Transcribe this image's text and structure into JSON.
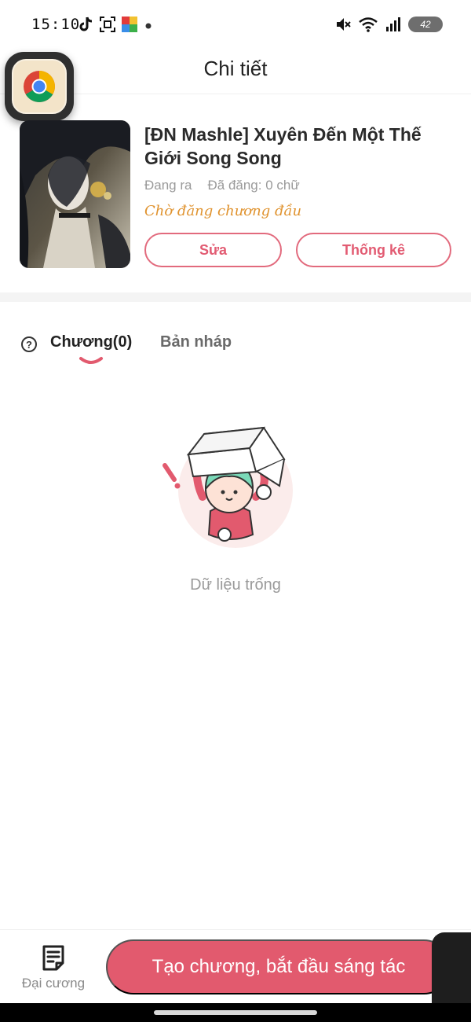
{
  "status_bar": {
    "time": "15:10",
    "left_icons": [
      "tiktok-icon",
      "scan-icon",
      "colorful-app-icon",
      "dot-icon"
    ],
    "right_icons": [
      "mute-icon",
      "wifi-icon",
      "signal-icon"
    ],
    "battery": "42"
  },
  "header": {
    "title": "Chi tiết"
  },
  "book": {
    "title": "[ĐN Mashle] Xuyên Đến Một Thế Giới Song Song",
    "status": "Đang ra",
    "word_count": "Đã đăng: 0 chữ",
    "waiting": "Chờ đăng chương đầu",
    "edit_label": "Sửa",
    "stats_label": "Thống kê"
  },
  "tabs": {
    "chapters": "Chương(0)",
    "drafts": "Bản nháp"
  },
  "empty": {
    "text": "Dữ liệu trống"
  },
  "bottom": {
    "outline_label": "Đại cương",
    "create_label": "Tạo chương, bắt đầu sáng tác"
  },
  "colors": {
    "accent": "#e25a6e",
    "waiting": "#e0932f",
    "muted_text": "#9a9a9a"
  }
}
